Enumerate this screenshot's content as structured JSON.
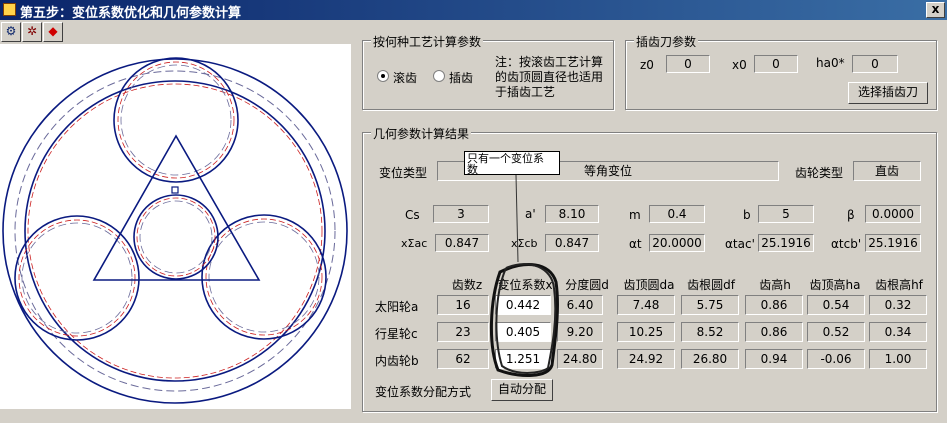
{
  "window": {
    "title": "第五步：变位系数优化和几何参数计算",
    "close": "x"
  },
  "toolbar": {
    "btn1": "⚙",
    "btn2": "✲",
    "btn3": "◆"
  },
  "process_group": {
    "title": "按何种工艺计算参数",
    "radio_hob": "滚齿",
    "radio_shape": "插齿",
    "note": "注：按滚齿工艺计算的齿顶圆直径也适用于插齿工艺",
    "note_line1": "注：按滚齿工艺计算",
    "note_line2": "的齿顶圆直径也适用",
    "note_line3": "于插齿工艺"
  },
  "cutter_group": {
    "title": "插齿刀参数",
    "z0_label": "z0",
    "z0": "0",
    "x0_label": "x0",
    "x0": "0",
    "ha0_label": "ha0*",
    "ha0": "0",
    "select_button": "选择插齿刀"
  },
  "results_group": {
    "title": "几何参数计算结果",
    "shift_type_label": "变位类型",
    "shift_type_value": "等角变位",
    "tooltip_line1": "只有一个变位系",
    "tooltip_line2": "数",
    "gear_type_label": "齿轮类型",
    "gear_type_value": "直齿",
    "params": {
      "cs_label": "Cs",
      "cs": "3",
      "a_label": "a'",
      "a": "8.10",
      "m_label": "m",
      "m": "0.4",
      "b_label": "b",
      "b": "5",
      "beta_label": "β",
      "beta": "0.0000",
      "xac_label": "xΣac",
      "xac": "0.847",
      "xcb_label": "xΣcb",
      "xcb": "0.847",
      "at_label": "αt",
      "at": "20.0000",
      "atac_label": "αtac'",
      "atac": "25.1916",
      "atcb_label": "αtcb'",
      "atcb": "25.1916"
    },
    "table": {
      "headers": [
        "齿数z",
        "变位系数x",
        "分度圆d",
        "齿顶圆da",
        "齿根圆df",
        "齿高h",
        "齿顶高ha",
        "齿根高hf"
      ],
      "rows": [
        {
          "name": "太阳轮a",
          "cells": [
            "16",
            "0.442",
            "6.40",
            "7.48",
            "5.75",
            "0.86",
            "0.54",
            "0.32"
          ]
        },
        {
          "name": "行星轮c",
          "cells": [
            "23",
            "0.405",
            "9.20",
            "10.25",
            "8.52",
            "0.86",
            "0.52",
            "0.34"
          ]
        },
        {
          "name": "内齿轮b",
          "cells": [
            "62",
            "1.251",
            "24.80",
            "24.92",
            "26.80",
            "0.94",
            "-0.06",
            "1.00"
          ]
        }
      ]
    },
    "alloc_label": "变位系数分配方式",
    "alloc_button": "自动分配"
  }
}
